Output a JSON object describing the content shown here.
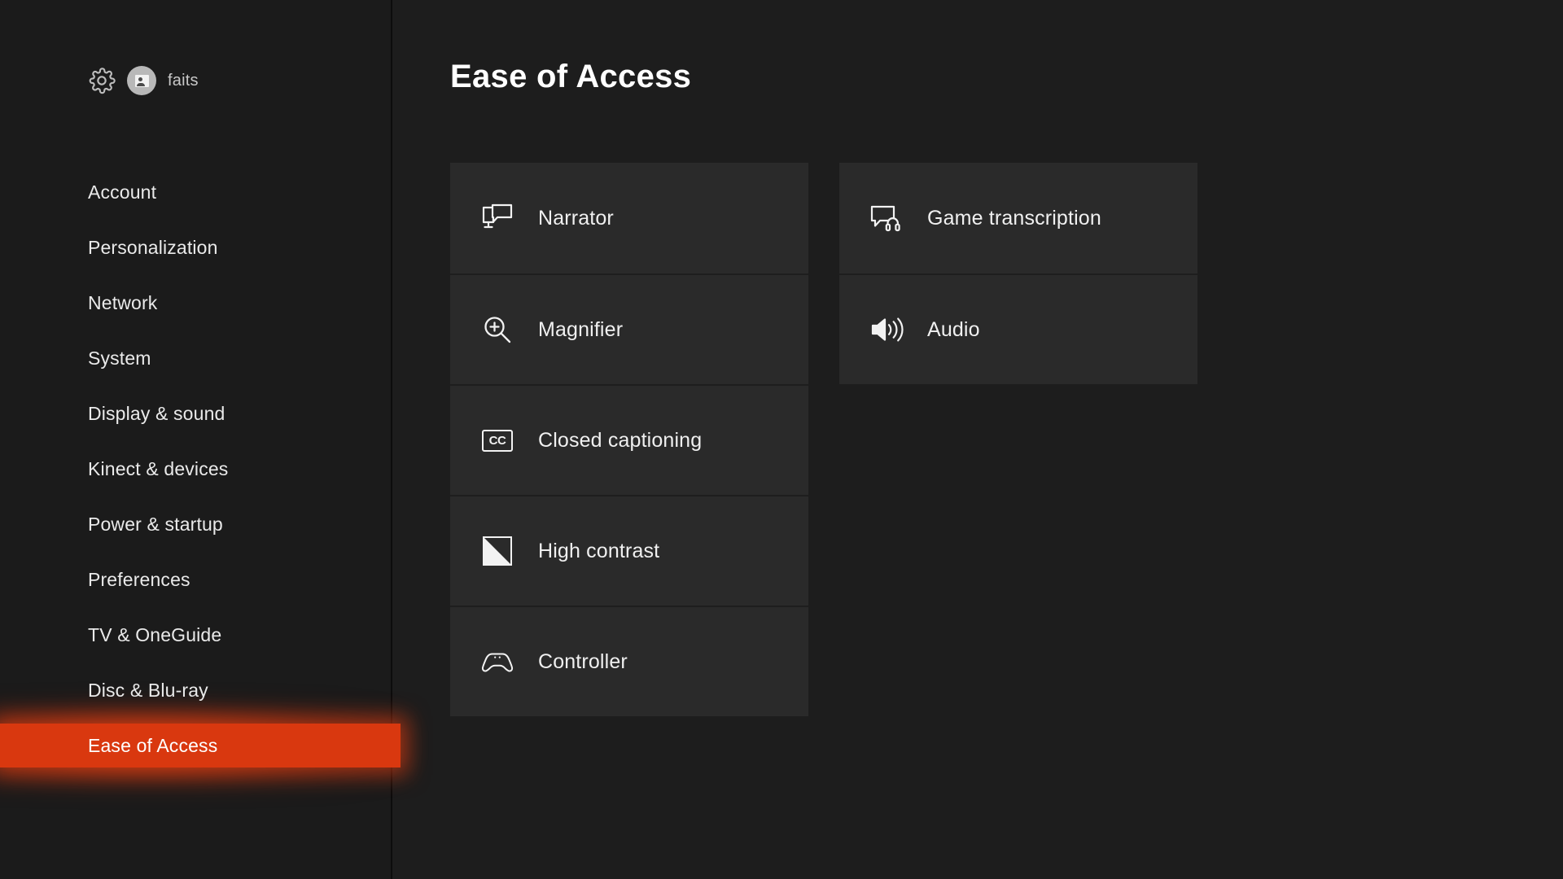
{
  "window": {
    "background_color": "#1d1d1d",
    "accent_color": "#d9380f"
  },
  "sidebar": {
    "gear_icon": "gear-icon",
    "avatar_icon": "avatar-gamerpic",
    "gamertag": "faits",
    "items": [
      {
        "label": "Account",
        "selected": false
      },
      {
        "label": "Personalization",
        "selected": false
      },
      {
        "label": "Network",
        "selected": false
      },
      {
        "label": "System",
        "selected": false
      },
      {
        "label": "Display & sound",
        "selected": false
      },
      {
        "label": "Kinect & devices",
        "selected": false
      },
      {
        "label": "Power & startup",
        "selected": false
      },
      {
        "label": "Preferences",
        "selected": false
      },
      {
        "label": "TV & OneGuide",
        "selected": false
      },
      {
        "label": "Disc & Blu-ray",
        "selected": false
      },
      {
        "label": "Ease of Access",
        "selected": true
      }
    ]
  },
  "main": {
    "title": "Ease of Access",
    "columns": [
      {
        "tiles": [
          {
            "label": "Narrator",
            "icon": "narrator-icon"
          },
          {
            "label": "Magnifier",
            "icon": "magnifier-icon"
          },
          {
            "label": "Closed captioning",
            "icon": "closed-captioning-icon",
            "icon_text": "CC"
          },
          {
            "label": "High contrast",
            "icon": "high-contrast-icon"
          },
          {
            "label": "Controller",
            "icon": "controller-icon"
          }
        ]
      },
      {
        "tiles": [
          {
            "label": "Game transcription",
            "icon": "game-transcription-icon"
          },
          {
            "label": "Audio",
            "icon": "audio-speaker-icon"
          }
        ]
      }
    ]
  }
}
